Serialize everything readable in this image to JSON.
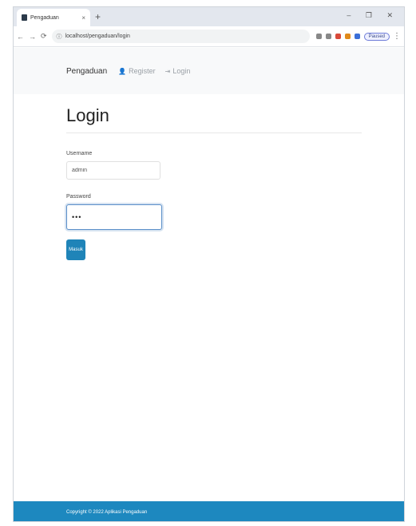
{
  "browser": {
    "tab_title": "Pengaduan",
    "tab_close": "×",
    "new_tab": "+",
    "window_controls": "– ❐ ✕",
    "nav_back": "←",
    "nav_forward": "→",
    "nav_reload": "⟳",
    "address": "localhost/pengaduan/login",
    "profile_label": "Paused",
    "menu_dots": "⋮"
  },
  "navbar": {
    "brand": "Pengaduan",
    "links": [
      {
        "label": "Register",
        "icon": "user-icon"
      },
      {
        "label": "Login",
        "icon": "login-icon"
      }
    ]
  },
  "login": {
    "title": "Login",
    "username_label": "Username",
    "username_value": "admin",
    "password_label": "Password",
    "password_value": "•••",
    "submit_label": "Masuk"
  },
  "footer": {
    "text": "Copyright © 2022 Aplikasi Pengaduan"
  }
}
